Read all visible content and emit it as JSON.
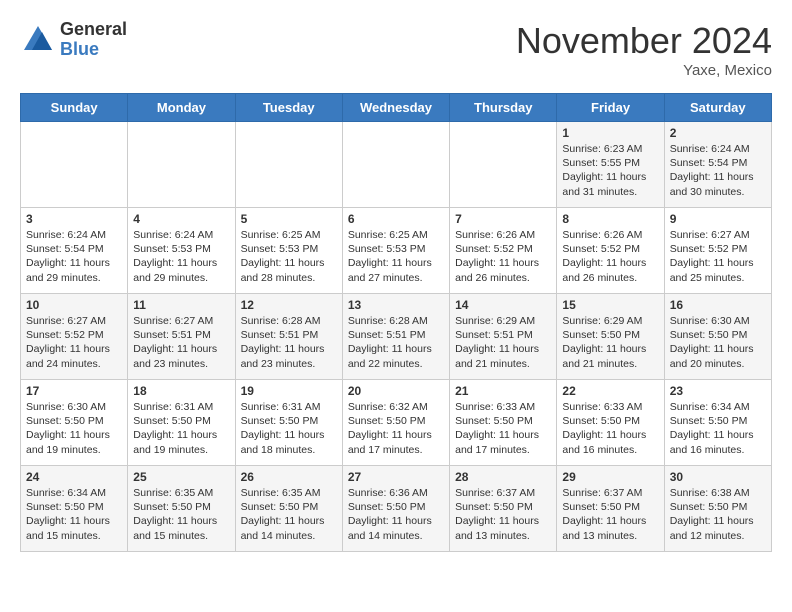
{
  "header": {
    "logo_general": "General",
    "logo_blue": "Blue",
    "month_title": "November 2024",
    "location": "Yaxe, Mexico"
  },
  "days_of_week": [
    "Sunday",
    "Monday",
    "Tuesday",
    "Wednesday",
    "Thursday",
    "Friday",
    "Saturday"
  ],
  "weeks": [
    [
      {
        "day": "",
        "info": ""
      },
      {
        "day": "",
        "info": ""
      },
      {
        "day": "",
        "info": ""
      },
      {
        "day": "",
        "info": ""
      },
      {
        "day": "",
        "info": ""
      },
      {
        "day": "1",
        "info": "Sunrise: 6:23 AM\nSunset: 5:55 PM\nDaylight: 11 hours and 31 minutes."
      },
      {
        "day": "2",
        "info": "Sunrise: 6:24 AM\nSunset: 5:54 PM\nDaylight: 11 hours and 30 minutes."
      }
    ],
    [
      {
        "day": "3",
        "info": "Sunrise: 6:24 AM\nSunset: 5:54 PM\nDaylight: 11 hours and 29 minutes."
      },
      {
        "day": "4",
        "info": "Sunrise: 6:24 AM\nSunset: 5:53 PM\nDaylight: 11 hours and 29 minutes."
      },
      {
        "day": "5",
        "info": "Sunrise: 6:25 AM\nSunset: 5:53 PM\nDaylight: 11 hours and 28 minutes."
      },
      {
        "day": "6",
        "info": "Sunrise: 6:25 AM\nSunset: 5:53 PM\nDaylight: 11 hours and 27 minutes."
      },
      {
        "day": "7",
        "info": "Sunrise: 6:26 AM\nSunset: 5:52 PM\nDaylight: 11 hours and 26 minutes."
      },
      {
        "day": "8",
        "info": "Sunrise: 6:26 AM\nSunset: 5:52 PM\nDaylight: 11 hours and 26 minutes."
      },
      {
        "day": "9",
        "info": "Sunrise: 6:27 AM\nSunset: 5:52 PM\nDaylight: 11 hours and 25 minutes."
      }
    ],
    [
      {
        "day": "10",
        "info": "Sunrise: 6:27 AM\nSunset: 5:52 PM\nDaylight: 11 hours and 24 minutes."
      },
      {
        "day": "11",
        "info": "Sunrise: 6:27 AM\nSunset: 5:51 PM\nDaylight: 11 hours and 23 minutes."
      },
      {
        "day": "12",
        "info": "Sunrise: 6:28 AM\nSunset: 5:51 PM\nDaylight: 11 hours and 23 minutes."
      },
      {
        "day": "13",
        "info": "Sunrise: 6:28 AM\nSunset: 5:51 PM\nDaylight: 11 hours and 22 minutes."
      },
      {
        "day": "14",
        "info": "Sunrise: 6:29 AM\nSunset: 5:51 PM\nDaylight: 11 hours and 21 minutes."
      },
      {
        "day": "15",
        "info": "Sunrise: 6:29 AM\nSunset: 5:50 PM\nDaylight: 11 hours and 21 minutes."
      },
      {
        "day": "16",
        "info": "Sunrise: 6:30 AM\nSunset: 5:50 PM\nDaylight: 11 hours and 20 minutes."
      }
    ],
    [
      {
        "day": "17",
        "info": "Sunrise: 6:30 AM\nSunset: 5:50 PM\nDaylight: 11 hours and 19 minutes."
      },
      {
        "day": "18",
        "info": "Sunrise: 6:31 AM\nSunset: 5:50 PM\nDaylight: 11 hours and 19 minutes."
      },
      {
        "day": "19",
        "info": "Sunrise: 6:31 AM\nSunset: 5:50 PM\nDaylight: 11 hours and 18 minutes."
      },
      {
        "day": "20",
        "info": "Sunrise: 6:32 AM\nSunset: 5:50 PM\nDaylight: 11 hours and 17 minutes."
      },
      {
        "day": "21",
        "info": "Sunrise: 6:33 AM\nSunset: 5:50 PM\nDaylight: 11 hours and 17 minutes."
      },
      {
        "day": "22",
        "info": "Sunrise: 6:33 AM\nSunset: 5:50 PM\nDaylight: 11 hours and 16 minutes."
      },
      {
        "day": "23",
        "info": "Sunrise: 6:34 AM\nSunset: 5:50 PM\nDaylight: 11 hours and 16 minutes."
      }
    ],
    [
      {
        "day": "24",
        "info": "Sunrise: 6:34 AM\nSunset: 5:50 PM\nDaylight: 11 hours and 15 minutes."
      },
      {
        "day": "25",
        "info": "Sunrise: 6:35 AM\nSunset: 5:50 PM\nDaylight: 11 hours and 15 minutes."
      },
      {
        "day": "26",
        "info": "Sunrise: 6:35 AM\nSunset: 5:50 PM\nDaylight: 11 hours and 14 minutes."
      },
      {
        "day": "27",
        "info": "Sunrise: 6:36 AM\nSunset: 5:50 PM\nDaylight: 11 hours and 14 minutes."
      },
      {
        "day": "28",
        "info": "Sunrise: 6:37 AM\nSunset: 5:50 PM\nDaylight: 11 hours and 13 minutes."
      },
      {
        "day": "29",
        "info": "Sunrise: 6:37 AM\nSunset: 5:50 PM\nDaylight: 11 hours and 13 minutes."
      },
      {
        "day": "30",
        "info": "Sunrise: 6:38 AM\nSunset: 5:50 PM\nDaylight: 11 hours and 12 minutes."
      }
    ]
  ]
}
